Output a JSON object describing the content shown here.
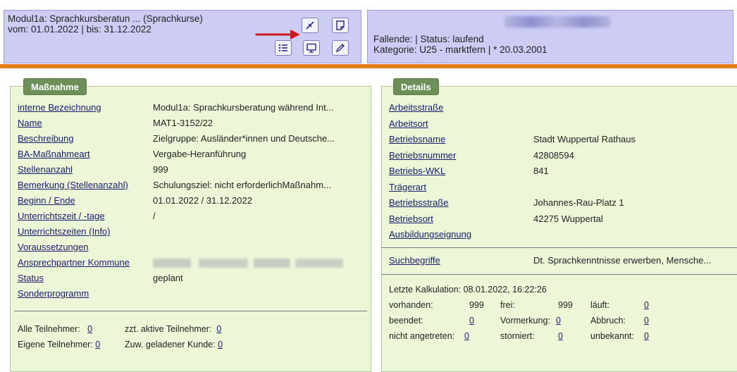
{
  "header": {
    "title_line": "Modul1a: Sprachkursberatun ...  (Sprachkurse)",
    "date_line": "vom: 01.01.2022 | bis: 31.12.2022",
    "person": {
      "fallende_line": "Fallende:   |  Status:  laufend",
      "kategorie_line": "Kategorie:  U25 - marktfern  |   * 20.03.2001"
    },
    "icons": [
      "pin-icon",
      "note-icon",
      "list-icon",
      "screen-icon",
      "pencil-icon"
    ]
  },
  "left_panel": {
    "tab": "Maßnahme",
    "fields": [
      {
        "label": "interne Bezeichnung",
        "value": "Modul1a: Sprachkursberatung während Int..."
      },
      {
        "label": "Name",
        "value": "MAT1-3152/22"
      },
      {
        "label": "Beschreibung",
        "value": "Zielgruppe: Ausländer*innen und Deutsche..."
      },
      {
        "label": "BA-Maßnahmeart",
        "value": "Vergabe-Heranführung"
      },
      {
        "label": "Stellenanzahl",
        "value": "999"
      },
      {
        "label": "Bemerkung (Stellenanzahl)",
        "value": "Schulungsziel: nicht erforderlichMaßnahm..."
      },
      {
        "label": "Beginn / Ende",
        "value": "01.01.2022 / 31.12.2022"
      },
      {
        "label": "Unterrichtszeit / -tage",
        "value": "/"
      },
      {
        "label": "Unterrichtszeiten (Info)",
        "value": ""
      },
      {
        "label": "Voraussetzungen",
        "value": ""
      },
      {
        "label": "Ansprechpartner Kommune",
        "value": ""
      },
      {
        "label": "Status",
        "value": "geplant"
      },
      {
        "label": "Sonderprogramm",
        "value": ""
      }
    ],
    "stats": {
      "alle_label": "Alle Teilnehmer:",
      "alle_value": "0",
      "aktive_label": "zzt. aktive Teilnehmer:",
      "aktive_value": "0",
      "eigene_label": "Eigene Teilnehmer:",
      "eigene_value": "0",
      "zuw_label": "Zuw. geladener Kunde:",
      "zuw_value": "0"
    }
  },
  "right_panel": {
    "tab": "Details",
    "fields": [
      {
        "label": "Arbeitsstraße",
        "value": ""
      },
      {
        "label": "Arbeitsort",
        "value": ""
      },
      {
        "label": "Betriebsname",
        "value": "Stadt Wuppertal Rathaus"
      },
      {
        "label": "Betriebsnummer",
        "value": "42808594"
      },
      {
        "label": "Betriebs-WKL",
        "value": "841"
      },
      {
        "label": "Trägerart",
        "value": ""
      },
      {
        "label": "Betriebsstraße",
        "value": "Johannes-Rau-Platz 1"
      },
      {
        "label": "Betriebsort",
        "value": "42275 Wuppertal"
      },
      {
        "label": "Ausbildungseignung",
        "value": ""
      }
    ],
    "suchbegriffe": {
      "label": "Suchbegriffe",
      "value": "Dt. Sprachkenntnisse erwerben, Mensche..."
    },
    "kalkulation": {
      "line": "Letzte Kalkulation: 08.01.2022, 16:22:26",
      "vorhanden_label": "vorhanden:",
      "vorhanden_value": "999",
      "frei_label": "frei:",
      "frei_value": "999",
      "laeuft_label": "läuft:",
      "laeuft_value": "0",
      "beendet_label": "beendet:",
      "beendet_value": "0",
      "vormerkung_label": "Vormerkung:",
      "vormerkung_value": "0",
      "abbruch_label": "Abbruch:",
      "abbruch_value": "0",
      "nicht_label": "nicht angetreten:",
      "nicht_value": "0",
      "storniert_label": "storniert:",
      "storniert_value": "0",
      "unbekannt_label": "unbekannt:",
      "unbekannt_value": "0"
    }
  },
  "colors": {
    "header_bg": "#ccccf5",
    "accent_bar": "#e47e18",
    "panel_bg": "#ecf7d8",
    "tab_bg": "#6f8f58"
  }
}
